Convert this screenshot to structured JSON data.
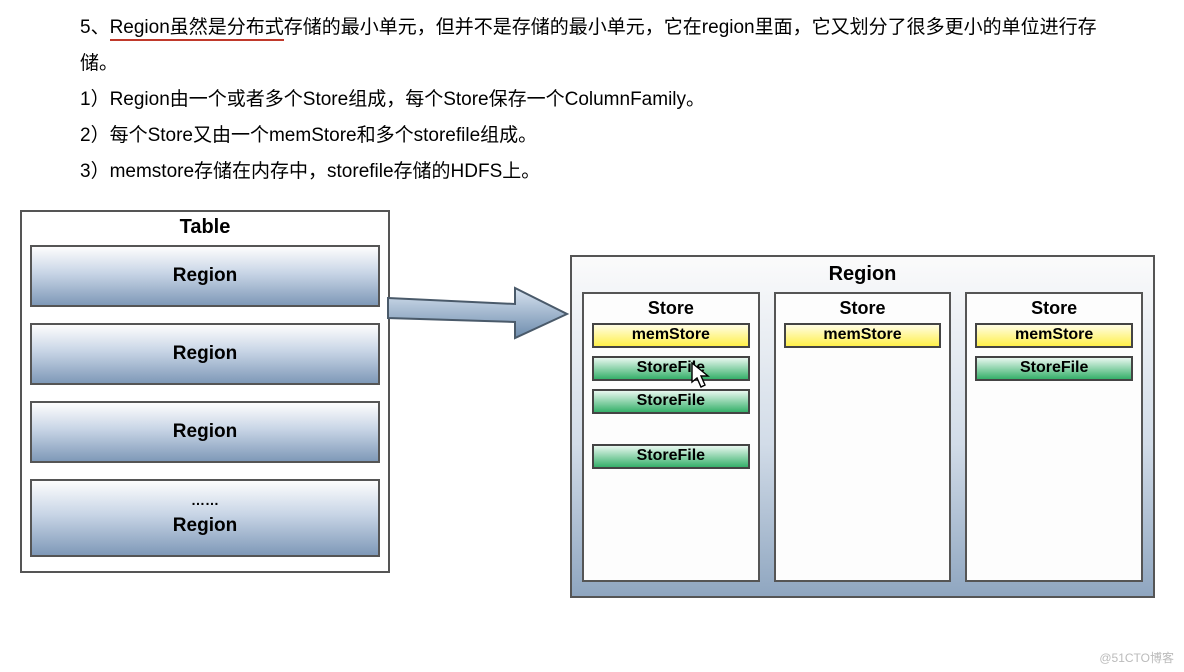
{
  "text": {
    "line1a": "5、",
    "line1b_underlined": "Region虽然是分布式",
    "line1c": "存储的最小单元，但并不是存储的最小单元，它在region里面，它又划分了很多更小的单位进行存储。",
    "line2": "1）Region由一个或者多个Store组成，每个Store保存一个ColumnFamily。",
    "line3": "2）每个Store又由一个memStore和多个storefile组成。",
    "line4": "3）memstore存储在内存中，storefile存储的HDFS上。"
  },
  "diagram": {
    "table_title": "Table",
    "regions": [
      "Region",
      "Region",
      "Region"
    ],
    "region_ellipsis_dots": "……",
    "region_ellipsis_label": "Region",
    "region_detail_title": "Region",
    "stores": [
      {
        "title": "Store",
        "mem": "memStore",
        "files": [
          "StoreFile",
          "StoreFile",
          "StoreFile"
        ],
        "gap_before_last": true
      },
      {
        "title": "Store",
        "mem": "memStore",
        "files": []
      },
      {
        "title": "Store",
        "mem": "memStore",
        "files": [
          "StoreFile"
        ]
      }
    ]
  },
  "watermark": "@51CTO博客"
}
